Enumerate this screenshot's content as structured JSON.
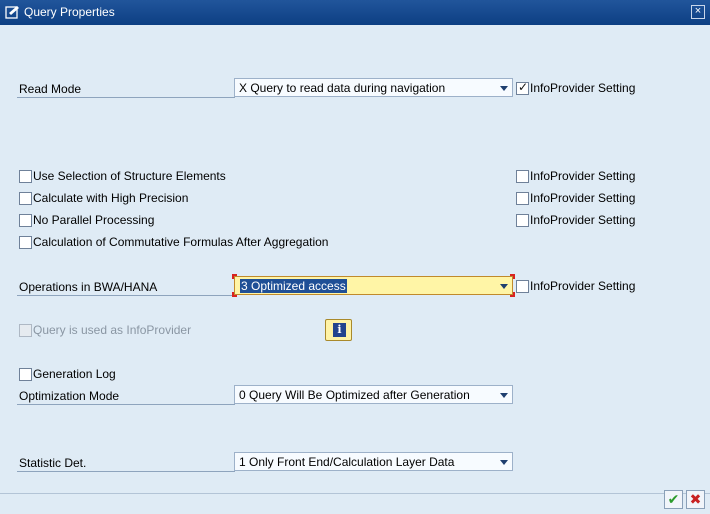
{
  "window": {
    "title": "Query Properties",
    "close_glyph": "×"
  },
  "fields": {
    "read_mode": {
      "label": "Read Mode",
      "value": "X Query to read data during navigation",
      "infoprov_label": "InfoProvider Setting",
      "infoprov_checked": true
    },
    "use_selection": {
      "label": "Use Selection of Structure Elements",
      "infoprov_label": "InfoProvider Setting"
    },
    "high_precision": {
      "label": "Calculate with High Precision",
      "infoprov_label": "InfoProvider Setting"
    },
    "no_parallel": {
      "label": "No Parallel Processing",
      "infoprov_label": "InfoProvider Setting"
    },
    "commutative": {
      "label": "Calculation of Commutative Formulas After Aggregation"
    },
    "operations_bwa": {
      "label": "Operations in BWA/HANA",
      "value": "3 Optimized access",
      "infoprov_label": "InfoProvider Setting"
    },
    "query_infoprovider": {
      "label": "Query is used as InfoProvider"
    },
    "generation_log": {
      "label": "Generation Log"
    },
    "optimization_mode": {
      "label": "Optimization Mode",
      "value": "0 Query Will Be Optimized after Generation"
    },
    "statistic_det": {
      "label": "Statistic Det.",
      "value": "1 Only Front End/Calculation Layer Data"
    }
  },
  "icons": {
    "title_icon": "properties-icon",
    "info_icon": "info-icon",
    "ok_icon": "checkmark-icon",
    "cancel_icon": "cancel-x-icon"
  },
  "glyphs": {
    "check": "✓",
    "info": "i",
    "ok": "✔",
    "cancel": "✖"
  }
}
